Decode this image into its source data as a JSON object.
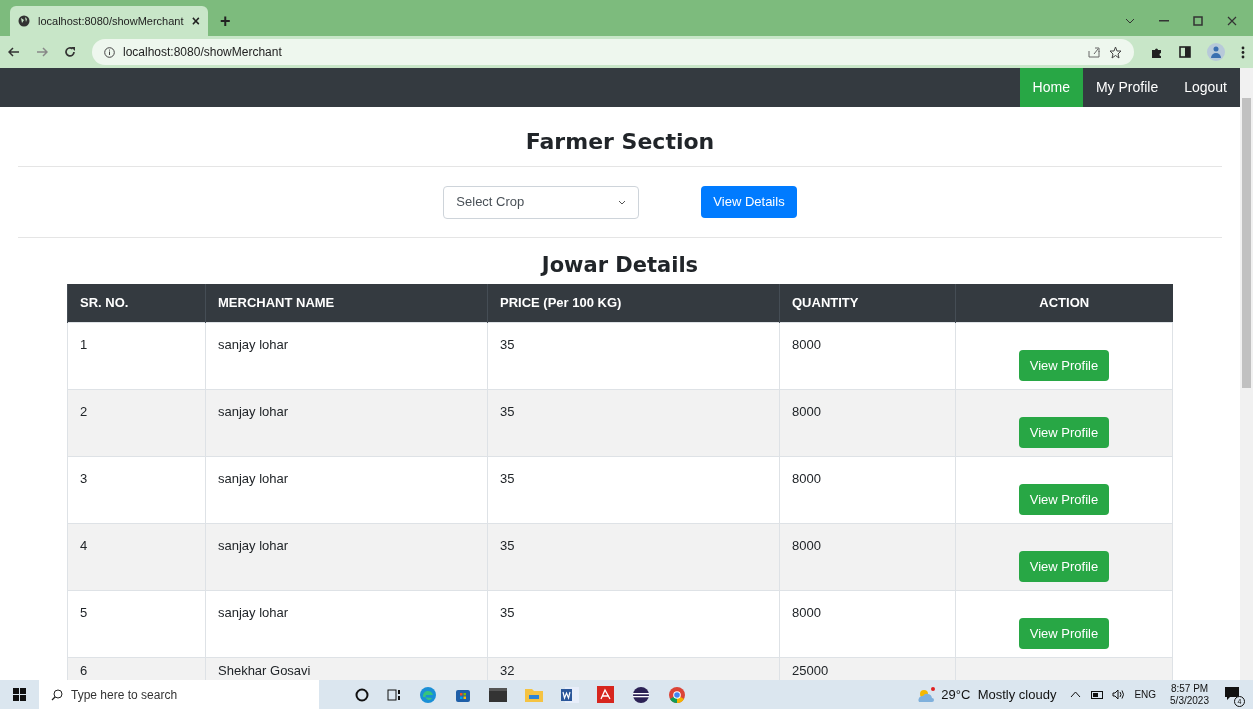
{
  "browser": {
    "tab_title": "localhost:8080/showMerchant",
    "tab_close": "×",
    "new_tab": "+",
    "url": "localhost:8080/showMerchant"
  },
  "nav": {
    "items": [
      {
        "label": "Home",
        "selected": true
      },
      {
        "label": "My Profile",
        "selected": false
      },
      {
        "label": "Logout",
        "selected": false
      }
    ]
  },
  "page": {
    "title": "Farmer Section",
    "crop_select": {
      "value": "Select Crop"
    },
    "view_button": "View Details",
    "table_title": "Jowar Details"
  },
  "table": {
    "columns": [
      "SR. NO.",
      "MERCHANT NAME",
      "PRICE (Per 100 KG)",
      "QUANTITY",
      "ACTION"
    ],
    "rows": [
      {
        "sr": "1",
        "name": "sanjay lohar",
        "price": "35",
        "quantity": "8000",
        "action": "View Profile"
      },
      {
        "sr": "2",
        "name": "sanjay lohar",
        "price": "35",
        "quantity": "8000",
        "action": "View Profile"
      },
      {
        "sr": "3",
        "name": "sanjay lohar",
        "price": "35",
        "quantity": "8000",
        "action": "View Profile"
      },
      {
        "sr": "4",
        "name": "sanjay lohar",
        "price": "35",
        "quantity": "8000",
        "action": "View Profile"
      },
      {
        "sr": "5",
        "name": "sanjay lohar",
        "price": "35",
        "quantity": "8000",
        "action": "View Profile"
      },
      {
        "sr": "6",
        "name": "Shekhar Gosavi",
        "price": "32",
        "quantity": "25000"
      }
    ]
  },
  "taskbar": {
    "search_placeholder": "Type here to search",
    "weather": "29°C  Mostly cloudy",
    "language": "ENG",
    "time": "8:57 PM",
    "date": "5/3/2023",
    "notifications": "4"
  }
}
